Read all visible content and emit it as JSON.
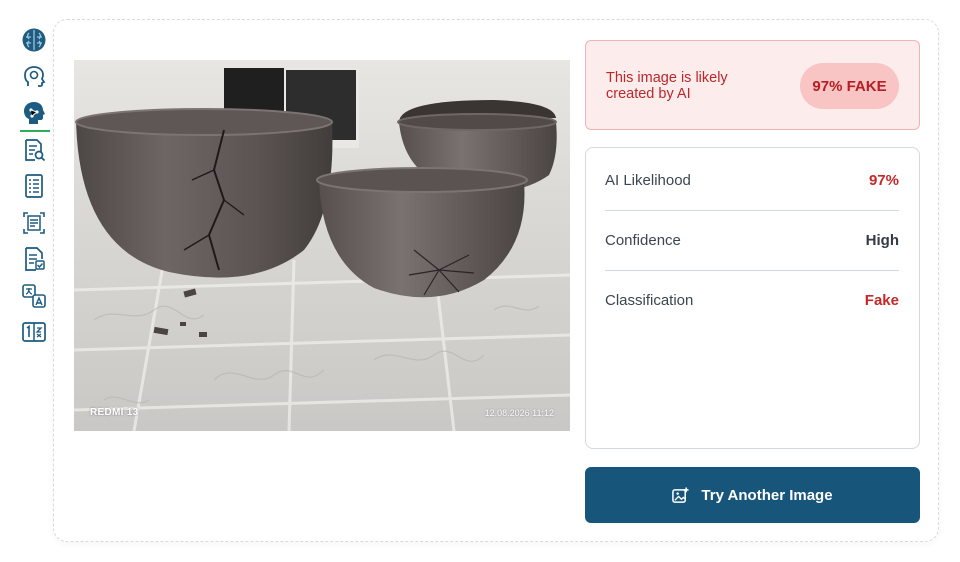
{
  "sidebar": {
    "items": [
      {
        "icon": "brain-icon"
      },
      {
        "icon": "head-profile-icon"
      },
      {
        "icon": "ai-head-icon",
        "active": true
      },
      {
        "icon": "document-search-icon"
      },
      {
        "icon": "document-list-icon"
      },
      {
        "icon": "ai-document-scan-icon"
      },
      {
        "icon": "document-check-icon"
      },
      {
        "icon": "translate-icon"
      },
      {
        "icon": "number-converter-icon"
      }
    ]
  },
  "photo": {
    "watermark_left": "REDMI 13",
    "watermark_right": "12.08.2026 11:12"
  },
  "verdict": {
    "text": "This image is likely created by AI",
    "badge": "97% FAKE"
  },
  "details": [
    {
      "label": "AI Likelihood",
      "value": "97%",
      "color": "#c62828"
    },
    {
      "label": "Confidence",
      "value": "High",
      "color": "#333b44"
    },
    {
      "label": "Classification",
      "value": "Fake",
      "color": "#c62828"
    }
  ],
  "actions": {
    "try_again_label": "Try Another Image"
  },
  "colors": {
    "brand": "#18557b",
    "accent_green": "#2fae58",
    "fake_red": "#c62828"
  }
}
